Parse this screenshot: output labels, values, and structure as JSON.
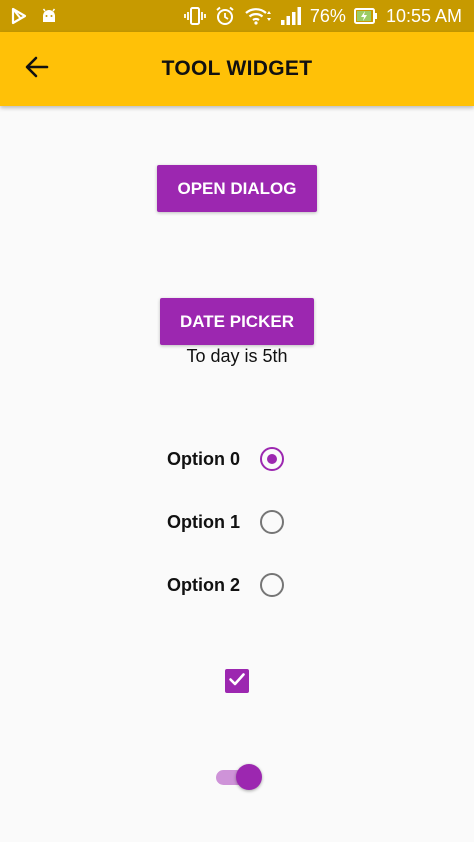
{
  "status_bar": {
    "battery_percent": "76%",
    "time": "10:55 AM",
    "icons": [
      "play-store-icon",
      "android-icon",
      "vibrate-icon",
      "alarm-icon",
      "wifi-icon",
      "cell-signal-icon",
      "battery-charging-icon"
    ]
  },
  "app_bar": {
    "title": "TOOL WIDGET",
    "back_icon": "arrow-back-icon",
    "background": "#ffc107"
  },
  "buttons": {
    "open_dialog": "OPEN DIALOG",
    "date_picker": "DATE PICKER"
  },
  "date_text": "To day is 5th",
  "radio_options": [
    {
      "label": "Option 0",
      "checked": true
    },
    {
      "label": "Option 1",
      "checked": false
    },
    {
      "label": "Option 2",
      "checked": false
    }
  ],
  "checkbox": {
    "checked": true
  },
  "switch": {
    "on": true
  },
  "colors": {
    "accent": "#9c27b0",
    "accent_light": "#ce93d8",
    "status_bar": "#c79a00",
    "background": "#fafafa"
  }
}
